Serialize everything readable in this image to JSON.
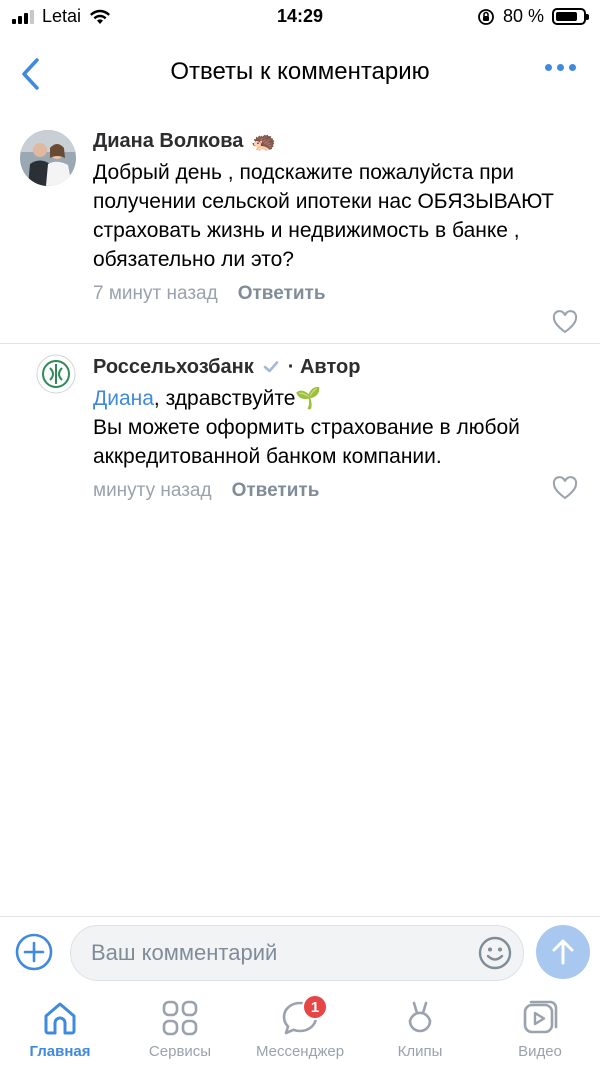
{
  "status_bar": {
    "carrier": "Letai",
    "time": "14:29",
    "battery": "80 %",
    "battery_level": 0.8
  },
  "nav": {
    "title": "Ответы к комментарию",
    "back_icon": "chevron-left-icon",
    "more_icon": "more-horizontal-icon"
  },
  "comments": [
    {
      "author": "Диана Волкова",
      "author_emoji": "🦔",
      "text": "Добрый день , подскажите пожалуйста при получении сельской ипотеки нас ОБЯЗЫВАЮТ страховать жизнь и недвижимость в банке , обязательно ли это?",
      "time": "7 минут назад",
      "reply_label": "Ответить"
    },
    {
      "author": "Россельхозбанк",
      "author_tag": "· Автор",
      "mention": "Диана",
      "greeting": ", здравствуйте🌱",
      "text": "Вы можете оформить страхование в любой аккредитованной банком компании.",
      "time": "минуту назад",
      "reply_label": "Ответить"
    }
  ],
  "composer": {
    "placeholder": "Ваш комментарий"
  },
  "tabs": [
    {
      "label": "Главная",
      "active": true
    },
    {
      "label": "Сервисы"
    },
    {
      "label": "Мессенджер",
      "badge": "1"
    },
    {
      "label": "Клипы"
    },
    {
      "label": "Видео"
    }
  ],
  "colors": {
    "accent": "#3f8ae0",
    "badge": "#e64646",
    "send_disabled": "#a8c8f0",
    "bank_green": "#2e8b57"
  }
}
